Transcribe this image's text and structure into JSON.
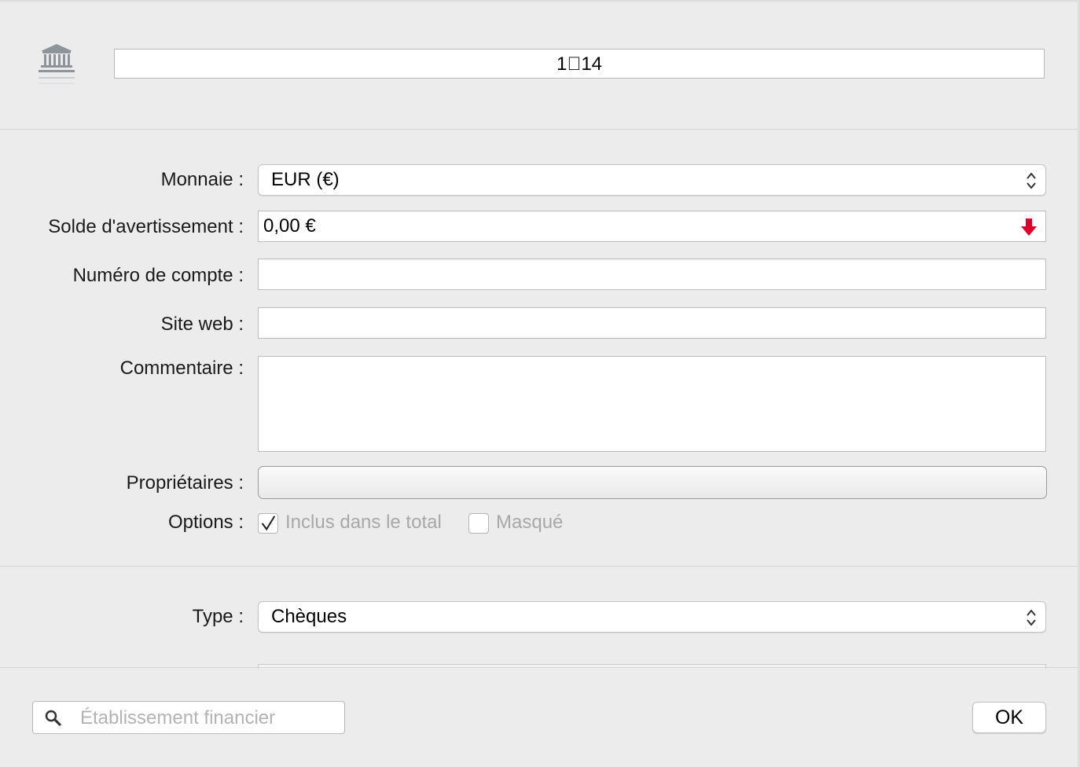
{
  "header": {
    "account_name": "114"
  },
  "form": {
    "currency_label": "Monnaie :",
    "currency_value": "EUR (€)",
    "warning_balance_label": "Solde d'avertissement :",
    "warning_balance_value": "0,00 €",
    "account_number_label": "Numéro de compte :",
    "account_number_value": "",
    "website_label": "Site web :",
    "website_value": "",
    "comment_label": "Commentaire :",
    "owners_label": "Propriétaires :",
    "options_label": "Options :",
    "options": [
      {
        "label": "Inclus dans le total",
        "checked": true
      },
      {
        "label": "Masqué",
        "checked": false
      }
    ],
    "type_label": "Type :",
    "type_value": "Chèques"
  },
  "footer": {
    "search_placeholder": "Établissement financier",
    "ok_label": "OK"
  },
  "colors": {
    "warning_arrow": "#e0002a",
    "disabled_text": "#a8a8a8"
  }
}
